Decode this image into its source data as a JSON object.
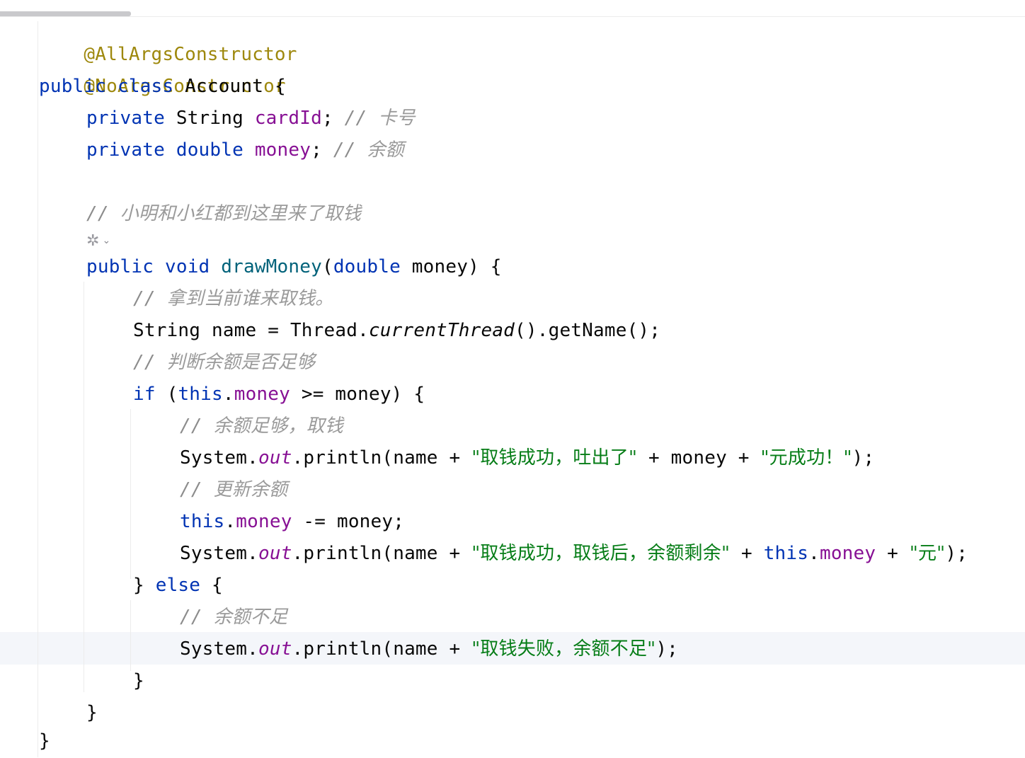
{
  "editor": {
    "language": "java",
    "lines": {
      "l1_annotation": "@AllArgsConstructor",
      "l2_annotation": "@NoArgsConstructor",
      "l3": {
        "kw1": "public",
        "kw2": "class",
        "name": "Account",
        "brace": " {"
      },
      "l4": {
        "kw": "private",
        "type": "String",
        "field": "cardId",
        "semi": ";",
        "comment_mark": "//",
        "comment_text": "卡号"
      },
      "l5": {
        "kw": "private",
        "type": "double",
        "field": "money",
        "semi": ";",
        "comment_mark": "//",
        "comment_text": "余额"
      },
      "l6": {
        "comment_mark": "//",
        "comment_text": "小明和小红都到这里来了取钱"
      },
      "l7": {
        "kw1": "public",
        "kw2": "void",
        "method": "drawMoney",
        "open": "(",
        "ptype": "double",
        "pname": "money",
        "close": ") {"
      },
      "l8": {
        "comment_mark": "//",
        "comment_text": "拿到当前谁来取钱。"
      },
      "l9": {
        "type": "String",
        "rest1": " name = Thread.",
        "smeth": "currentThread",
        "rest2": "().getName();"
      },
      "l10": {
        "comment_mark": "//",
        "comment_text": "判断余额是否足够"
      },
      "l11": {
        "kw": "if",
        "open": " (",
        "this": "this",
        "dot": ".",
        "field": "money",
        "rest": " >= money) {"
      },
      "l12": {
        "comment_mark": "//",
        "comment_text": "余额足够，取钱"
      },
      "l13": {
        "p1": "System.",
        "out": "out",
        "p2": ".println(name + ",
        "s1": "\"取钱成功，吐出了\"",
        "p3": " + money + ",
        "s2": "\"元成功！\"",
        "p4": ");"
      },
      "l14": {
        "comment_mark": "//",
        "comment_text": "更新余额"
      },
      "l15": {
        "this": "this",
        "dot": ".",
        "field": "money",
        "rest": " -= money;"
      },
      "l16": {
        "p1": "System.",
        "out": "out",
        "p2": ".println(name + ",
        "s1": "\"取钱成功，取钱后，余额剩余\"",
        "p3": " + ",
        "this": "this",
        "dot": ".",
        "field": "money",
        "p4": " + ",
        "s2": "\"元\"",
        "p5": ");"
      },
      "l17": {
        "brace": "} ",
        "kw": "else",
        "rest": " {"
      },
      "l18": {
        "comment_mark": "//",
        "comment_text": "余额不足"
      },
      "l19": {
        "p1": "System.",
        "out": "out",
        "p2": ".println(name + ",
        "s1": "\"取钱失败，余额不足\"",
        "p3": ");"
      },
      "l20": "}",
      "l21": "}",
      "l22": "}"
    },
    "gutter_hint": {
      "icon": "ai-sparkle-icon",
      "chevron": "chevron-down-icon"
    }
  }
}
